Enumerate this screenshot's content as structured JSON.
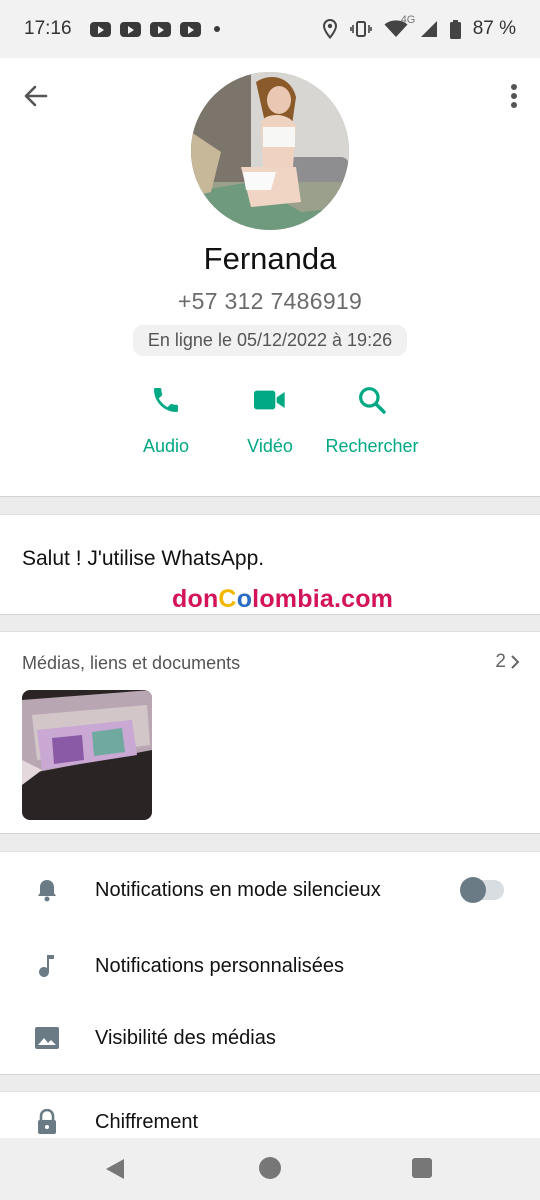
{
  "status_bar": {
    "time": "17:16",
    "network": "4G",
    "battery": "87 %",
    "icons": [
      "youtube-icon",
      "youtube-icon",
      "youtube-icon",
      "youtube-icon",
      "location-icon",
      "vibrate-icon",
      "wifi-icon",
      "signal-icon",
      "battery-icon"
    ]
  },
  "header": {
    "back_icon": "arrow-back-icon",
    "menu_icon": "more-vert-icon",
    "name": "Fernanda",
    "phone": "+57 312 7486919",
    "last_seen": "En ligne le 05/12/2022 à 19:26"
  },
  "actions": [
    {
      "label": "Audio",
      "icon": "phone-icon"
    },
    {
      "label": "Vidéo",
      "icon": "video-icon"
    },
    {
      "label": "Rechercher",
      "icon": "search-icon"
    }
  ],
  "about": {
    "text": "Salut ! J'utilise WhatsApp.",
    "watermark": {
      "don": "don",
      "c": "C",
      "o": "o",
      "rest": "lombia.com"
    }
  },
  "media": {
    "title": "Médias, liens et documents",
    "count": "2"
  },
  "settings": [
    {
      "label": "Notifications en mode silencieux",
      "icon": "bell-icon",
      "toggle": false
    },
    {
      "label": "Notifications personnalisées",
      "icon": "music-note-icon"
    },
    {
      "label": "Visibilité des médias",
      "icon": "image-icon"
    }
  ],
  "encryption": {
    "label": "Chiffrement",
    "icon": "lock-icon"
  },
  "colors": {
    "accent": "#00a884",
    "icon_gray": "#6b7b86"
  }
}
